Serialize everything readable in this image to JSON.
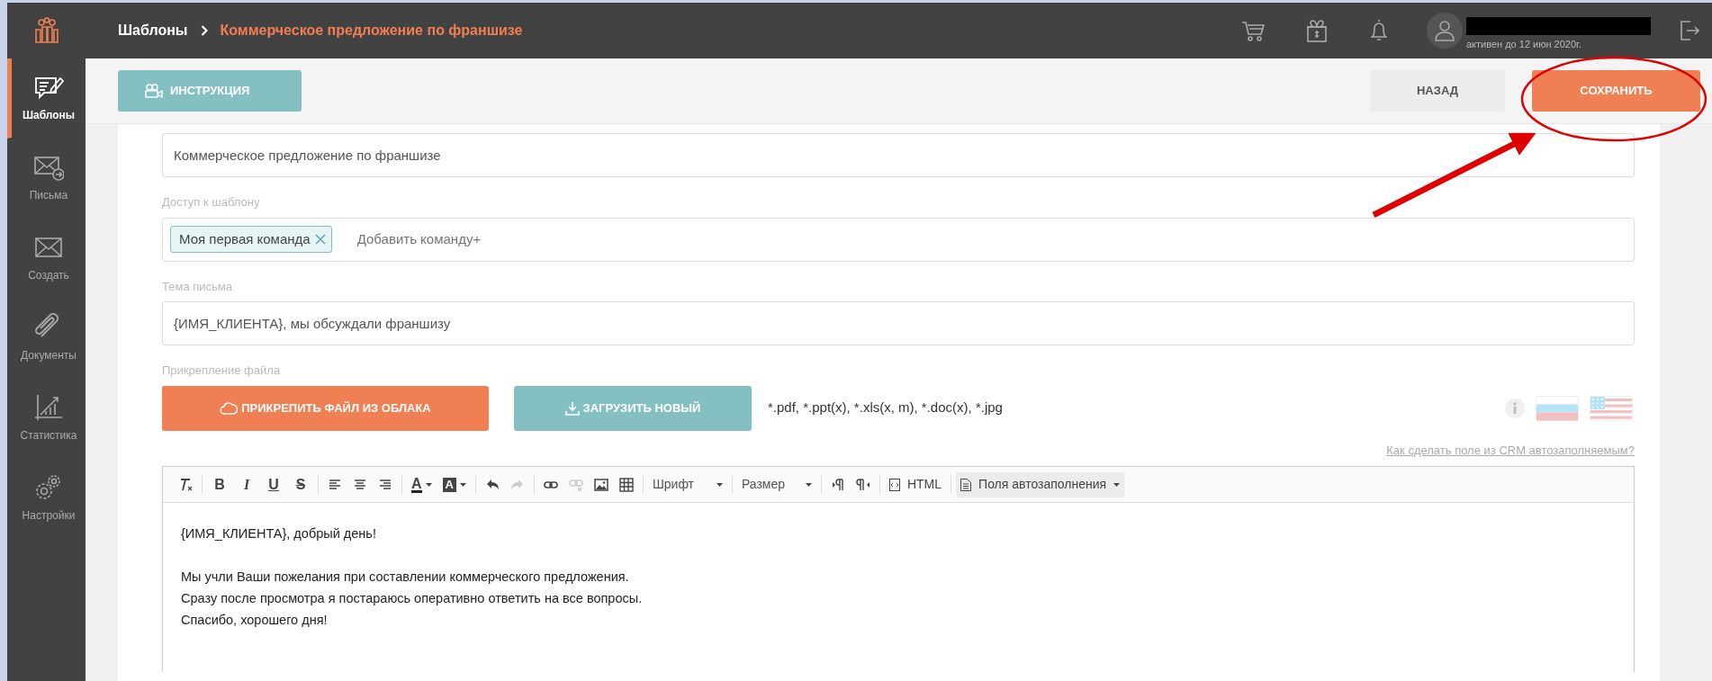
{
  "header": {
    "breadcrumb": [
      {
        "label": "Шаблоны"
      },
      {
        "label": "Коммерческое предложение по франшизе"
      }
    ],
    "user": {
      "subscription": "активен до 12 июн 2020г."
    }
  },
  "sidebar": {
    "items": [
      {
        "label": "Шаблоны",
        "selected": true
      },
      {
        "label": "Письма",
        "selected": false
      },
      {
        "label": "Создать",
        "selected": false
      },
      {
        "label": "Документы",
        "selected": false
      },
      {
        "label": "Статистика",
        "selected": false
      },
      {
        "label": "Настройки",
        "selected": false
      }
    ]
  },
  "toolbar": {
    "instruction": "ИНСТРУКЦИЯ",
    "back": "НАЗАД",
    "save": "СОХРАНИТЬ"
  },
  "form": {
    "template_name": {
      "value": "Коммерческое предложение по франшизе"
    },
    "access": {
      "label": "Доступ к шаблону",
      "tags": [
        {
          "label": "Моя первая команда"
        }
      ],
      "placeholder": "Добавить команду+"
    },
    "subject": {
      "label": "Тема письма",
      "value": "{ИМЯ_КЛИЕНТА}, мы обсуждали франшизу"
    },
    "attachment": {
      "label": "Прикрепление файла",
      "cloud_button": "ПРИКРЕПИТЬ ФАЙЛ ИЗ ОБЛАКА",
      "upload_button": "ЗАГРУЗИТЬ НОВЫЙ",
      "formats": "*.pdf, *.ppt(x), *.xls(x, m), *.doc(x), *.jpg"
    },
    "autofill_help": "Как сделать поле из CRM автозаполняемым?"
  },
  "editor": {
    "toolbar": [
      {
        "kind": "icon"
      },
      {
        "kind": "sep"
      },
      {
        "kind": "letter",
        "label": "B"
      },
      {
        "kind": "letter",
        "label": "I"
      },
      {
        "kind": "letter",
        "label": "U"
      },
      {
        "kind": "letter",
        "label": "S"
      },
      {
        "kind": "sep"
      },
      {
        "kind": "icon"
      },
      {
        "kind": "icon"
      },
      {
        "kind": "icon"
      },
      {
        "kind": "sep"
      },
      {
        "kind": "color",
        "label": "A"
      },
      {
        "kind": "bgcolor",
        "label": "A"
      },
      {
        "kind": "sep"
      },
      {
        "kind": "icon"
      },
      {
        "kind": "icon",
        "disabled": true
      },
      {
        "kind": "sep"
      },
      {
        "kind": "icon"
      },
      {
        "kind": "icon",
        "disabled": true
      },
      {
        "kind": "icon"
      },
      {
        "kind": "icon"
      },
      {
        "kind": "sep"
      },
      {
        "kind": "select",
        "label": "Шрифт"
      },
      {
        "kind": "sep"
      },
      {
        "kind": "select",
        "label": "Размер"
      },
      {
        "kind": "sep"
      },
      {
        "kind": "icon"
      },
      {
        "kind": "icon"
      },
      {
        "kind": "sep"
      },
      {
        "kind": "button",
        "label": "HTML"
      },
      {
        "kind": "sep"
      },
      {
        "kind": "menu",
        "label": "Поля автозаполнения"
      }
    ],
    "body": [
      [
        "{ИМЯ_КЛИЕНТА}, добрый день!"
      ],
      [
        "Мы учли Ваши пожелания при составлении коммерческого предложения.",
        "Сразу после просмотра я постараюсь оперативно ответить на все вопросы.",
        "Спасибо, хорошего дня!"
      ]
    ]
  }
}
